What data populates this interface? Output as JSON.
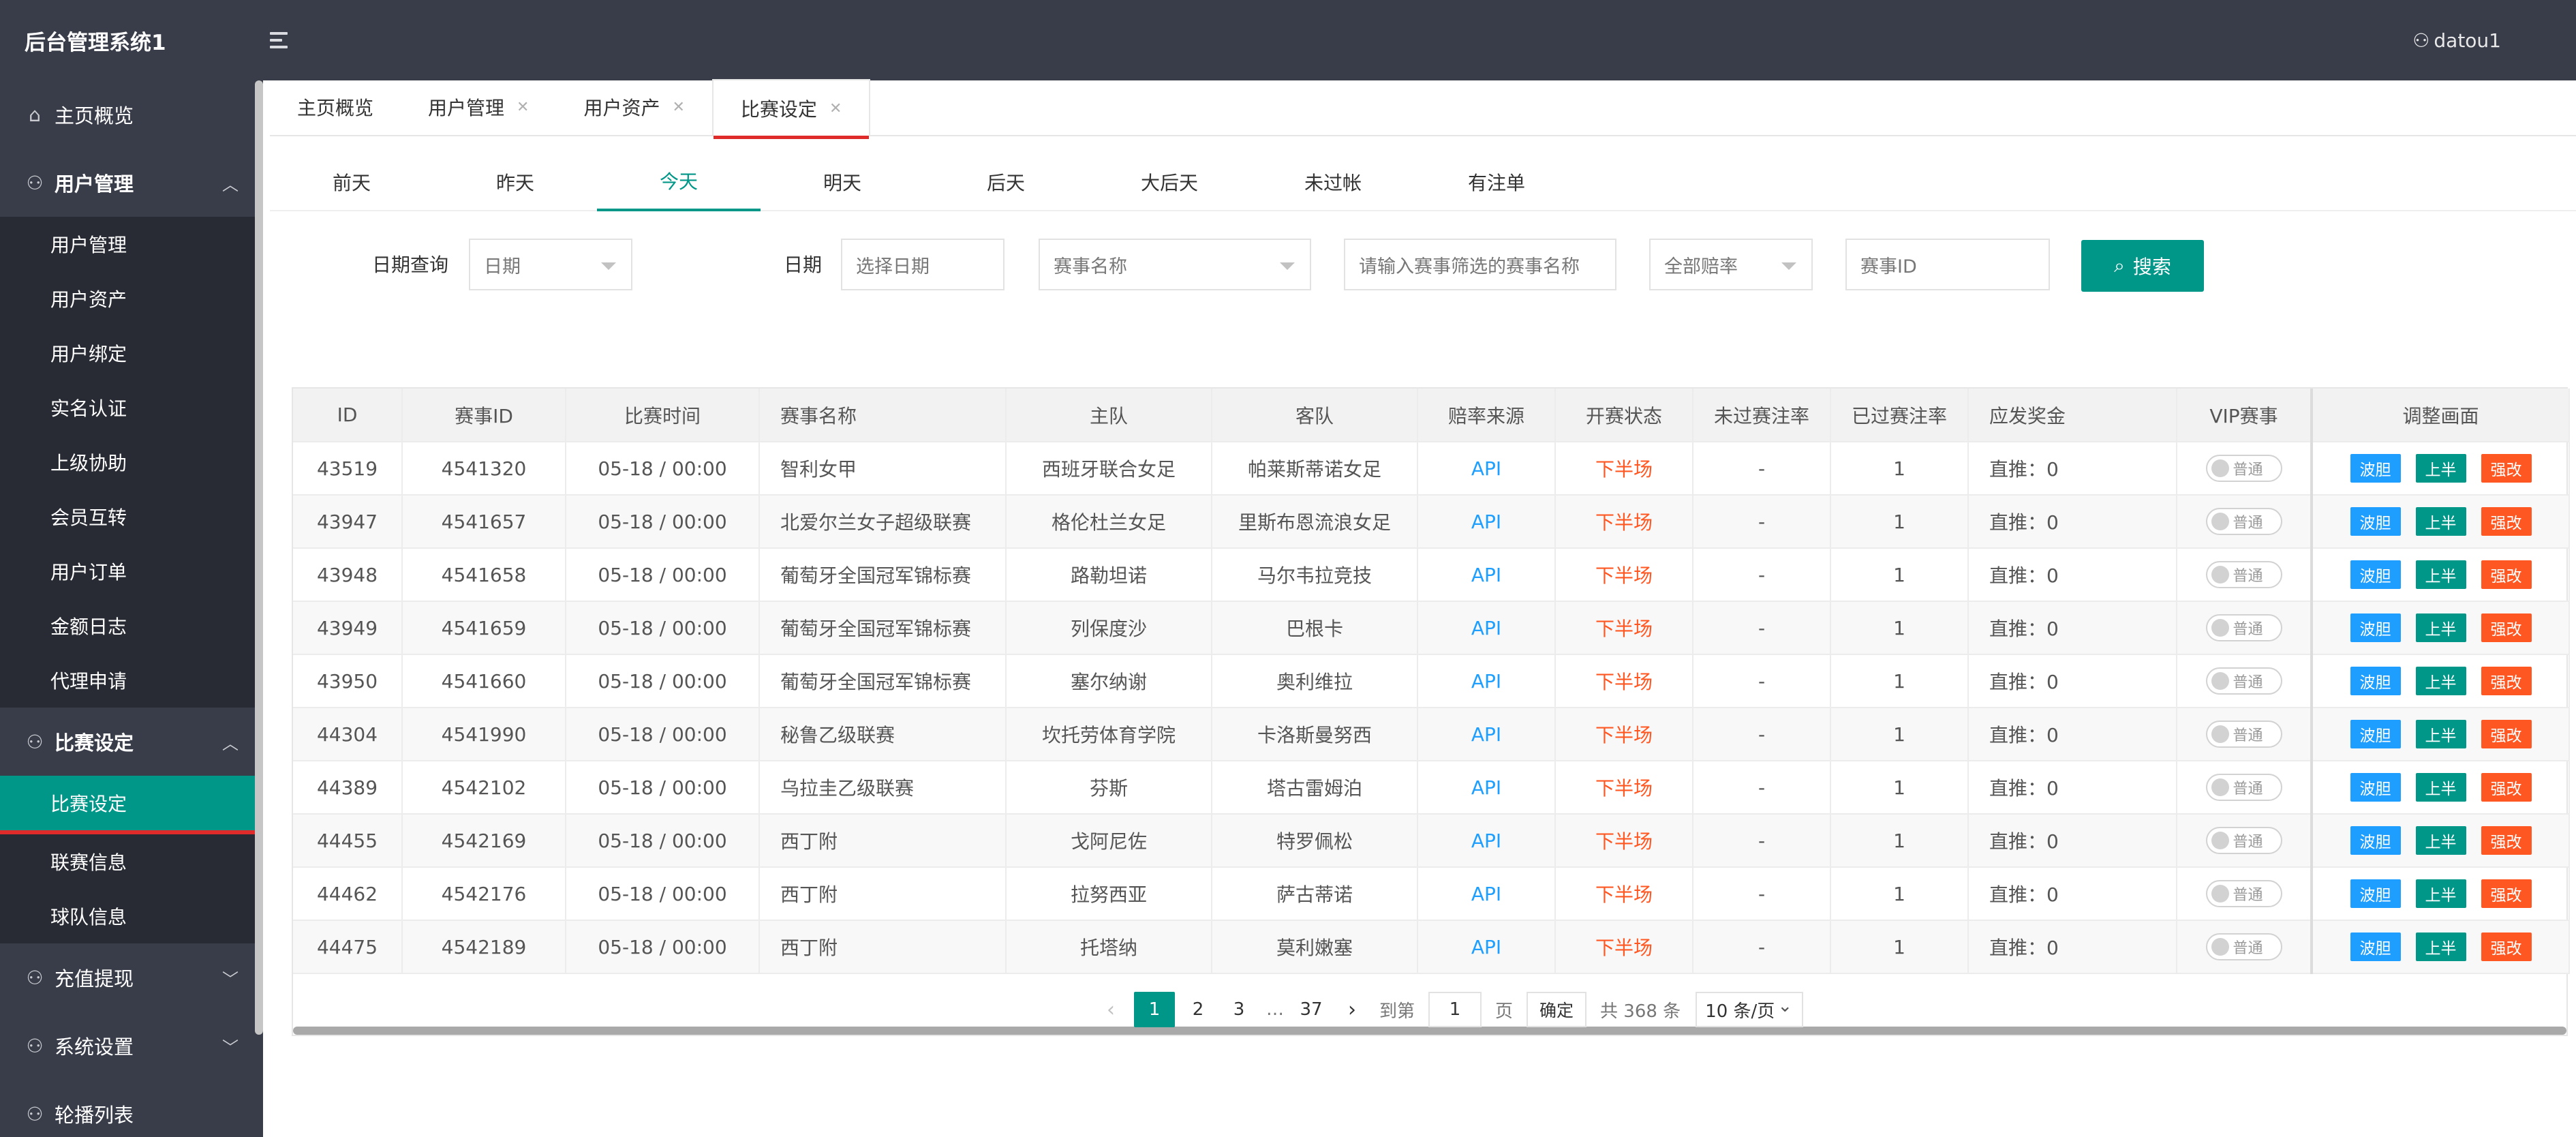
{
  "app": {
    "title": "后台管理系统1",
    "user": "datou1"
  },
  "sidebar": {
    "home": "主页概览",
    "user_group": {
      "label": "用户管理",
      "items": [
        "用户管理",
        "用户资产",
        "用户绑定",
        "实名认证",
        "上级协助",
        "会员互转",
        "用户订单",
        "金额日志",
        "代理申请"
      ]
    },
    "match_group": {
      "label": "比赛设定",
      "items": [
        "比赛设定",
        "联赛信息",
        "球队信息"
      ]
    },
    "recharge": "充值提现",
    "system": "系统设置",
    "cut": "轮播列表"
  },
  "page_tabs": [
    "主页概览",
    "用户管理",
    "用户资产",
    "比赛设定"
  ],
  "day_tabs": [
    "前天",
    "昨天",
    "今天",
    "明天",
    "后天",
    "大后天",
    "未过帐",
    "有注单"
  ],
  "filters": {
    "date_query_label": "日期查询",
    "date_type": "日期",
    "date_label": "日期",
    "date_placeholder": "选择日期",
    "league_placeholder": "赛事名称",
    "league_name_placeholder": "请输入赛事筛选的赛事名称",
    "odds": "全部赔率",
    "match_id_placeholder": "赛事ID",
    "search": "搜索"
  },
  "table": {
    "columns": [
      "ID",
      "赛事ID",
      "比赛时间",
      "赛事名称",
      "主队",
      "客队",
      "赔率来源",
      "开赛状态",
      "未过赛注率",
      "已过赛注率",
      "应发奖金",
      "VIP赛事",
      "调整画面"
    ],
    "rows": [
      {
        "id": "43519",
        "match_id": "4541320",
        "time": "05-18 / 00:00",
        "league": "智利女甲",
        "home": "西班牙联合女足",
        "away": "帕莱斯蒂诺女足",
        "source": "API",
        "status": "下半场",
        "unsettled": "-",
        "settled": "1",
        "bonus": "直推：0"
      },
      {
        "id": "43947",
        "match_id": "4541657",
        "time": "05-18 / 00:00",
        "league": "北爱尔兰女子超级联赛",
        "home": "格伦杜兰女足",
        "away": "里斯布恩流浪女足",
        "source": "API",
        "status": "下半场",
        "unsettled": "-",
        "settled": "1",
        "bonus": "直推：0"
      },
      {
        "id": "43948",
        "match_id": "4541658",
        "time": "05-18 / 00:00",
        "league": "葡萄牙全国冠军锦标赛",
        "home": "路勒坦诺",
        "away": "马尔韦拉竞技",
        "source": "API",
        "status": "下半场",
        "unsettled": "-",
        "settled": "1",
        "bonus": "直推：0"
      },
      {
        "id": "43949",
        "match_id": "4541659",
        "time": "05-18 / 00:00",
        "league": "葡萄牙全国冠军锦标赛",
        "home": "列保度沙",
        "away": "巴根卡",
        "source": "API",
        "status": "下半场",
        "unsettled": "-",
        "settled": "1",
        "bonus": "直推：0"
      },
      {
        "id": "43950",
        "match_id": "4541660",
        "time": "05-18 / 00:00",
        "league": "葡萄牙全国冠军锦标赛",
        "home": "塞尔纳谢",
        "away": "奥利维拉",
        "source": "API",
        "status": "下半场",
        "unsettled": "-",
        "settled": "1",
        "bonus": "直推：0"
      },
      {
        "id": "44304",
        "match_id": "4541990",
        "time": "05-18 / 00:00",
        "league": "秘鲁乙级联赛",
        "home": "坎托劳体育学院",
        "away": "卡洛斯曼努西",
        "source": "API",
        "status": "下半场",
        "unsettled": "-",
        "settled": "1",
        "bonus": "直推：0"
      },
      {
        "id": "44389",
        "match_id": "4542102",
        "time": "05-18 / 00:00",
        "league": "乌拉圭乙级联赛",
        "home": "芬斯",
        "away": "塔古雷姆泊",
        "source": "API",
        "status": "下半场",
        "unsettled": "-",
        "settled": "1",
        "bonus": "直推：0"
      },
      {
        "id": "44455",
        "match_id": "4542169",
        "time": "05-18 / 00:00",
        "league": "西丁附",
        "home": "戈阿尼佐",
        "away": "特罗佩松",
        "source": "API",
        "status": "下半场",
        "unsettled": "-",
        "settled": "1",
        "bonus": "直推：0"
      },
      {
        "id": "44462",
        "match_id": "4542176",
        "time": "05-18 / 00:00",
        "league": "西丁附",
        "home": "拉努西亚",
        "away": "萨古蒂诺",
        "source": "API",
        "status": "下半场",
        "unsettled": "-",
        "settled": "1",
        "bonus": "直推：0"
      },
      {
        "id": "44475",
        "match_id": "4542189",
        "time": "05-18 / 00:00",
        "league": "西丁附",
        "home": "托塔纳",
        "away": "莫利嫩塞",
        "source": "API",
        "status": "下半场",
        "unsettled": "-",
        "settled": "1",
        "bonus": "直推：0"
      }
    ],
    "vip_label": "普通",
    "actions": [
      "波胆",
      "上半",
      "强改"
    ]
  },
  "pagination": {
    "pages": [
      "1",
      "2",
      "3"
    ],
    "ellipsis": "…",
    "last": "37",
    "goto_label": "到第",
    "goto_value": "1",
    "page_unit": "页",
    "confirm": "确定",
    "total": "共 368 条",
    "page_size": "10 条/页"
  },
  "colors": {
    "primary": "#009688",
    "header": "#393d49",
    "link": "#1e9fff",
    "warning": "#ff5722",
    "active_indicator": "#e02b2b"
  }
}
